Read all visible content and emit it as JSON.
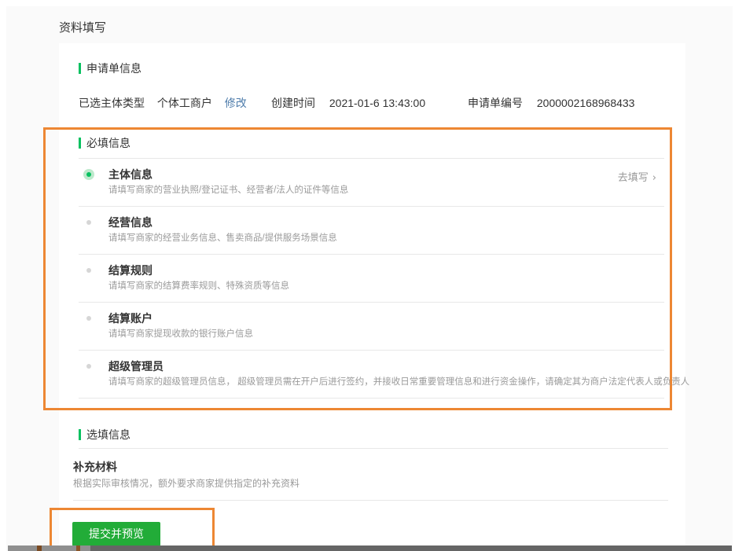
{
  "page": {
    "title": "资料填写"
  },
  "application_info": {
    "section_title": "申请单信息",
    "subject_type_label": "已选主体类型",
    "subject_type_value": "个体工商户",
    "modify_link": "修改",
    "created_label": "创建时间",
    "created_value": "2021-01-6 13:43:00",
    "application_no_label": "申请单编号",
    "application_no_value": "2000002168968433"
  },
  "required_info": {
    "section_title": "必填信息",
    "go_fill_label": "去填写",
    "chevron": "›",
    "items": [
      {
        "title": "主体信息",
        "desc": "请填写商家的营业执照/登记证书、经营者/法人的证件等信息",
        "status": "selected"
      },
      {
        "title": "经营信息",
        "desc": "请填写商家的经营业务信息、售卖商品/提供服务场景信息",
        "status": "pending"
      },
      {
        "title": "结算规则",
        "desc": "请填写商家的结算费率规则、特殊资质等信息",
        "status": "pending"
      },
      {
        "title": "结算账户",
        "desc": "请填写商家提现收款的银行账户信息",
        "status": "pending"
      },
      {
        "title": "超级管理员",
        "desc": "请填写商家的超级管理员信息， 超级管理员需在开户后进行签约，并接收日常重要管理信息和进行资金操作，请确定其为商户法定代表人或负责人",
        "status": "pending"
      }
    ]
  },
  "optional_info": {
    "section_title": "选填信息",
    "items": [
      {
        "title": "补充材料",
        "desc": "根据实际审核情况，额外要求商家提供指定的补充资料"
      }
    ]
  },
  "actions": {
    "submit_label": "提交并预览"
  },
  "colors": {
    "accent_green": "#07c160",
    "button_green": "#22ac38",
    "link_blue": "#4e7cab",
    "highlight_orange": "#ed8733",
    "page_background": "#fafafa"
  }
}
